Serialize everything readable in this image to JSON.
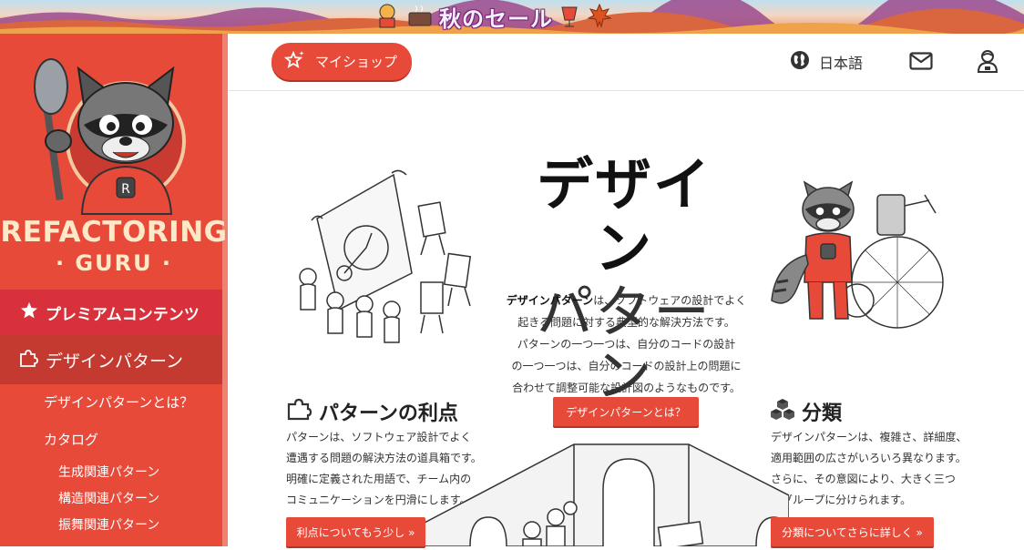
{
  "banner": {
    "title": "秋のセール"
  },
  "sidebar": {
    "logo_line1": "REFACTORING",
    "logo_line2": "· GURU ·",
    "premium_label": "プレミアムコンテンツ",
    "patterns_label": "デザインパターン",
    "items": [
      {
        "label": "デザインパターンとは？"
      },
      {
        "label": "カタログ"
      }
    ],
    "subitems": [
      {
        "label": "生成関連パターン"
      },
      {
        "label": "構造関連パターン"
      },
      {
        "label": "振舞関連パターン"
      }
    ]
  },
  "header": {
    "myshop_label": "マイショップ",
    "language": "日本語"
  },
  "hero": {
    "title_line1": "デザイン",
    "title_line2": "パターン",
    "intro_bold": "デザインパターン",
    "intro_rest_1": "は、ソフトウェアの設計でよく",
    "intro_lines": [
      "起きる問題に対する典型的な解決方法です。",
      "パターンの一つ一つは、自分のコードの設計",
      "の一つ一つは、自分のコードの設計上の問題に",
      "合わせて調整可能な設計図のようなものです。"
    ],
    "button_label": "デザインパターンとは？"
  },
  "benefits": {
    "title": "パターンの利点",
    "lines": [
      "パターンは、ソフトウェア設計でよく",
      "遭遇する問題の解決方法の道具箱です。",
      "明確に定義された用語で、チーム内の",
      "コミュニケーションを円滑にします。"
    ],
    "button_label": "利点についてもう少し »"
  },
  "classification": {
    "title": "分類",
    "lines": [
      "デザインパターンは、複雑さ、詳細度、",
      "適用範囲の広さがいろいろ異なります。",
      "さらに、その意図により、大きく三つ",
      "のグループに分けられます。"
    ],
    "button_label": "分類についてさらに詳しく »"
  },
  "colors": {
    "brand_red": "#e84a3a",
    "premium_red": "#d8313c",
    "active_nav": "#c43a30",
    "logo_cream": "#fde8c8"
  },
  "icons": [
    "star-icon",
    "puzzle-icon",
    "globe-icon",
    "mail-icon",
    "user-icon",
    "boxes-icon"
  ]
}
